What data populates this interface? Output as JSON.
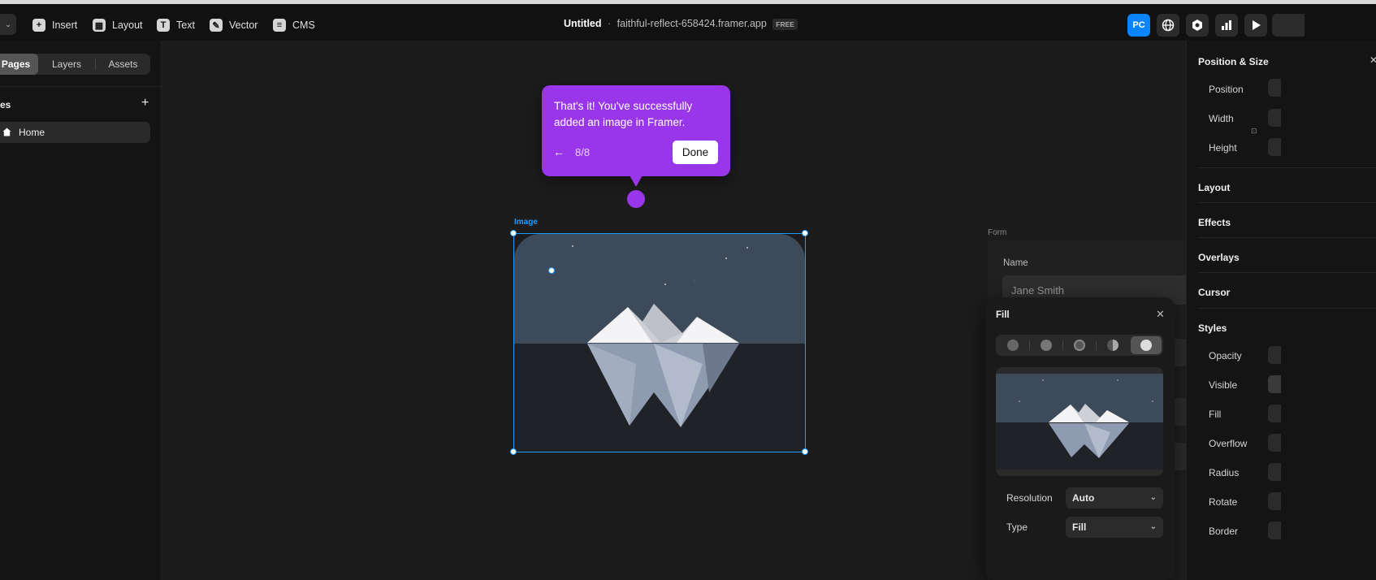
{
  "topbar": {
    "tools": [
      {
        "label": "Insert",
        "icon": "plus-square-icon"
      },
      {
        "label": "Layout",
        "icon": "layout-icon"
      },
      {
        "label": "Text",
        "icon": "text-icon"
      },
      {
        "label": "Vector",
        "icon": "pen-icon"
      },
      {
        "label": "CMS",
        "icon": "database-icon"
      }
    ],
    "project_name": "Untitled",
    "separator": "·",
    "domain": "faithful-reflect-658424.framer.app",
    "plan_badge": "FREE",
    "device_button": "PC",
    "accent": "#0a84ff"
  },
  "left": {
    "tabs": [
      "Pages",
      "Layers",
      "Assets"
    ],
    "section_title": "es",
    "add_label": "+",
    "pages": [
      {
        "label": "Home"
      }
    ]
  },
  "tooltip": {
    "message": "That's it! You've successfully added an image in Framer.",
    "step": "8/8",
    "done_label": "Done",
    "color": "#9a36ea"
  },
  "canvas": {
    "selection_label": "Image",
    "form_label": "Form",
    "name_label": "Name",
    "name_placeholder": "Jane Smith"
  },
  "fill_popover": {
    "title": "Fill",
    "resolution_label": "Resolution",
    "resolution_value": "Auto",
    "type_label": "Type",
    "type_value": "Fill"
  },
  "right": {
    "sections": {
      "position_size": "Position & Size",
      "layout": "Layout",
      "effects": "Effects",
      "overlays": "Overlays",
      "cursor": "Cursor",
      "styles": "Styles"
    },
    "position_rows": [
      "Position",
      "Width",
      "Height"
    ],
    "style_rows": [
      "Opacity",
      "Visible",
      "Fill",
      "Overflow",
      "Radius",
      "Rotate",
      "Border"
    ]
  }
}
